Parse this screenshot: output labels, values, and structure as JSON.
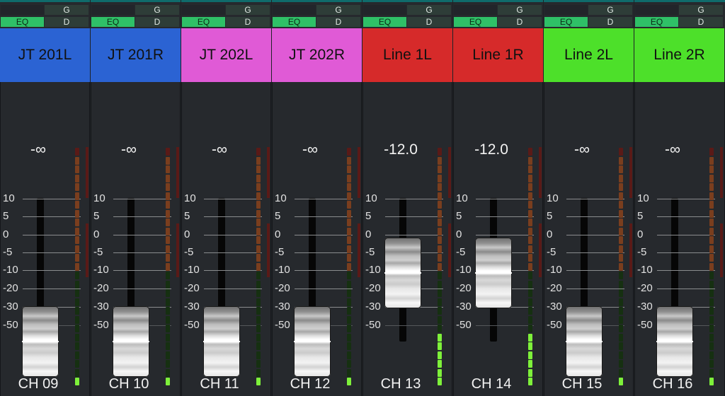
{
  "buttons": {
    "eq": "EQ",
    "g": "G",
    "d": "D"
  },
  "scale": [
    "10",
    "5",
    "0",
    "-5",
    "-10",
    "-20",
    "-30",
    "-50"
  ],
  "colors": {
    "blue": "#2b63d3",
    "pink": "#e05ad6",
    "red": "#d62a2a",
    "green": "#4de02a",
    "eq_active": "#2fc067",
    "meter_lit": "#7ef13a",
    "meter_green_dim": "#163011",
    "meter_orange_dim": "#7a3e1e",
    "meter_red_dim": "#5a1a17"
  },
  "channels": [
    {
      "name": "JT 201L",
      "ch": "CH 09",
      "level": "-∞",
      "fader_db": -100,
      "meter_lit": 1,
      "color": "blue"
    },
    {
      "name": "JT 201R",
      "ch": "CH 10",
      "level": "-∞",
      "fader_db": -100,
      "meter_lit": 1,
      "color": "blue"
    },
    {
      "name": "JT 202L",
      "ch": "CH 11",
      "level": "-∞",
      "fader_db": -100,
      "meter_lit": 1,
      "color": "pink"
    },
    {
      "name": "JT 202R",
      "ch": "CH 12",
      "level": "-∞",
      "fader_db": -100,
      "meter_lit": 1,
      "color": "pink"
    },
    {
      "name": "Line 1L",
      "ch": "CH 13",
      "level": "-12.0",
      "fader_db": -12,
      "meter_lit": 6,
      "color": "red"
    },
    {
      "name": "Line 1R",
      "ch": "CH 14",
      "level": "-12.0",
      "fader_db": -12,
      "meter_lit": 6,
      "color": "red"
    },
    {
      "name": "Line 2L",
      "ch": "CH 15",
      "level": "-∞",
      "fader_db": -100,
      "meter_lit": 1,
      "color": "green"
    },
    {
      "name": "Line 2R",
      "ch": "CH 16",
      "level": "-∞",
      "fader_db": -100,
      "meter_lit": 1,
      "color": "green"
    }
  ]
}
